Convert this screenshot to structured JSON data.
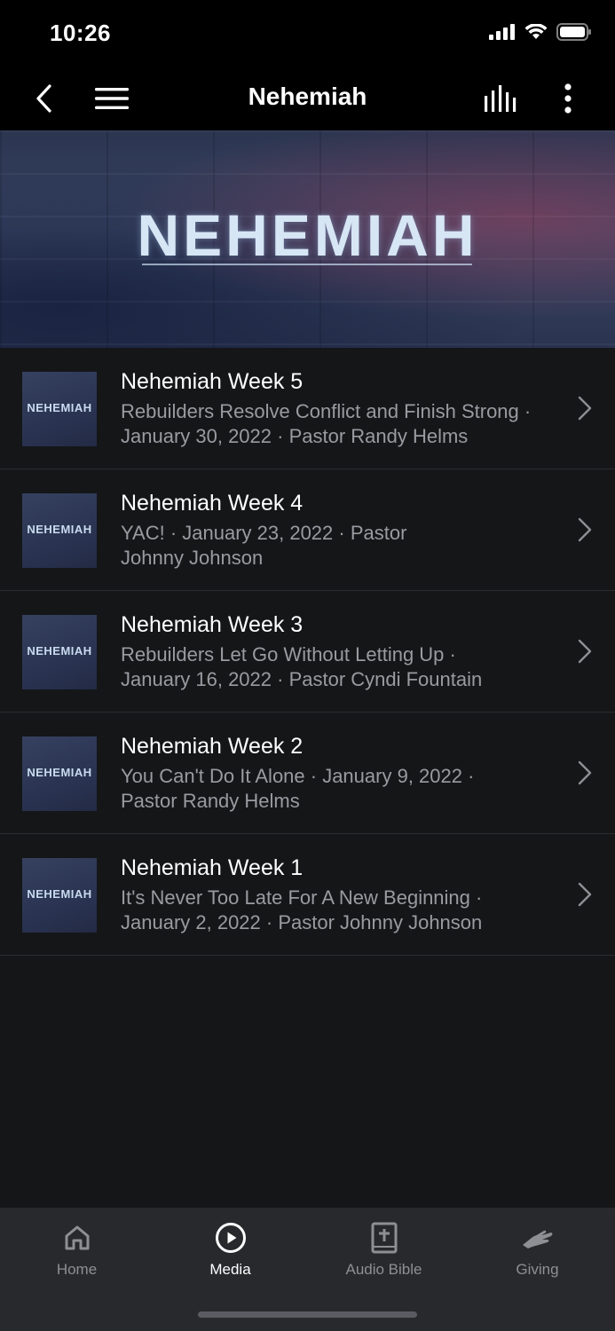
{
  "status": {
    "time": "10:26"
  },
  "nav": {
    "title": "Nehemiah"
  },
  "banner": {
    "title": "NEHEMIAH"
  },
  "items": [
    {
      "title": "Nehemiah Week 5",
      "subtitle": "Rebuilders Resolve Conflict and Finish Strong · January 30, 2022 · Pastor Randy Helms",
      "thumb": "NEHEMIAH"
    },
    {
      "title": "Nehemiah Week 4",
      "subtitle": "YAC! · January 23, 2022 · Pastor Johnny Johnson",
      "thumb": "NEHEMIAH"
    },
    {
      "title": "Nehemiah Week 3",
      "subtitle": "Rebuilders Let Go Without Letting Up · January 16, 2022 · Pastor Cyndi Fountain",
      "thumb": "NEHEMIAH"
    },
    {
      "title": "Nehemiah Week 2",
      "subtitle": "You Can't Do It Alone · January 9, 2022 · Pastor Randy Helms",
      "thumb": "NEHEMIAH"
    },
    {
      "title": "Nehemiah Week 1",
      "subtitle": "It's Never Too Late For A New Beginning · January 2, 2022 · Pastor Johnny Johnson",
      "thumb": "NEHEMIAH"
    }
  ],
  "tabs": [
    {
      "label": "Home",
      "icon": "home-icon"
    },
    {
      "label": "Media",
      "icon": "play-circle-icon",
      "active": true
    },
    {
      "label": "Audio Bible",
      "icon": "bible-icon"
    },
    {
      "label": "Giving",
      "icon": "giving-hand-icon"
    }
  ],
  "colors": {
    "background": "#151618",
    "bar": "#000000",
    "tabbar": "#28292d",
    "muted": "#9a9ba0"
  }
}
